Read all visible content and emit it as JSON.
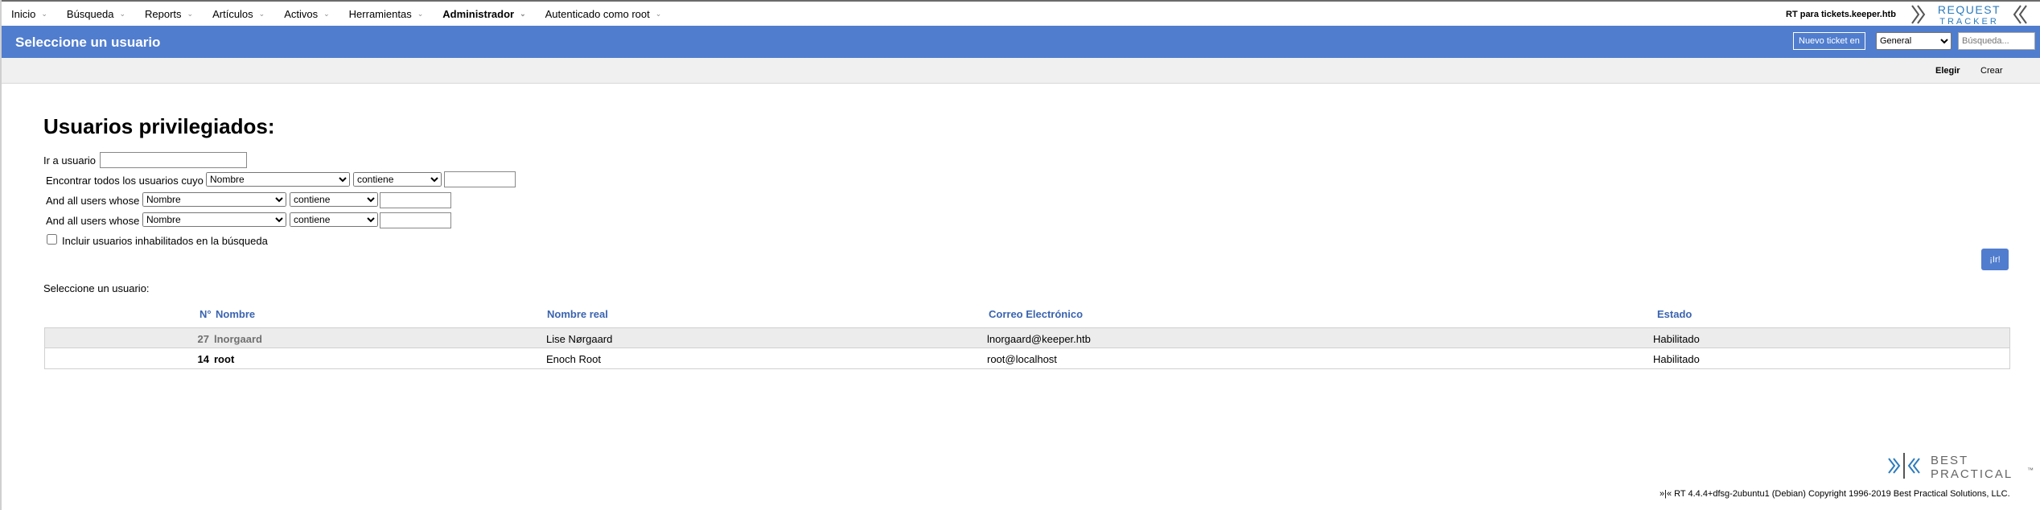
{
  "menu": {
    "items": [
      {
        "label": "Inicio"
      },
      {
        "label": "Búsqueda"
      },
      {
        "label": "Reports"
      },
      {
        "label": "Artículos"
      },
      {
        "label": "Activos"
      },
      {
        "label": "Herramientas"
      },
      {
        "label": "Administrador"
      },
      {
        "label": "Autenticado como root"
      }
    ],
    "site_name": "RT para tickets.keeper.htb",
    "logo_text_top": "REQUEST",
    "logo_text_bottom": "TRACKER"
  },
  "header": {
    "title": "Seleccione un usuario",
    "new_ticket_label": "Nuevo ticket en",
    "queue_selected": "General",
    "search_placeholder": "Búsqueda..."
  },
  "page_menu": {
    "elegir": "Elegir",
    "crear": "Crear"
  },
  "content": {
    "heading": "Usuarios privilegiados:",
    "goto_label": "Ir a usuario",
    "filters": [
      {
        "label": "Encontrar todos los usuarios cuyo",
        "field": "Nombre",
        "op": "contiene"
      },
      {
        "label": "And all users whose",
        "field": "Nombre",
        "op": "contiene"
      },
      {
        "label": "And all users whose",
        "field": "Nombre",
        "op": "contiene"
      }
    ],
    "include_disabled_label": "Incluir usuarios inhabilitados en la búsqueda",
    "go_label": "¡Ir!",
    "select_user_label": "Seleccione un usuario:"
  },
  "table": {
    "headers": {
      "id": "N°",
      "name": "Nombre",
      "real_name": "Nombre real",
      "email": "Correo Electrónico",
      "status": "Estado"
    },
    "rows": [
      {
        "id": "27",
        "name": "lnorgaard",
        "real_name": "Lise Nørgaard",
        "email": "lnorgaard@keeper.htb",
        "status": "Habilitado"
      },
      {
        "id": "14",
        "name": "root",
        "real_name": "Enoch Root",
        "email": "root@localhost",
        "status": "Habilitado"
      }
    ]
  },
  "footer": {
    "logo_top": "BEST",
    "logo_bottom": "PRACTICAL",
    "tm": "™",
    "copyright": "»|« RT 4.4.4+dfsg-2ubuntu1 (Debian) Copyright 1996-2019 Best Practical Solutions, LLC."
  },
  "colors": {
    "accent": "#507dce",
    "link": "#3a64b0",
    "logo": "#2c7bbd"
  }
}
